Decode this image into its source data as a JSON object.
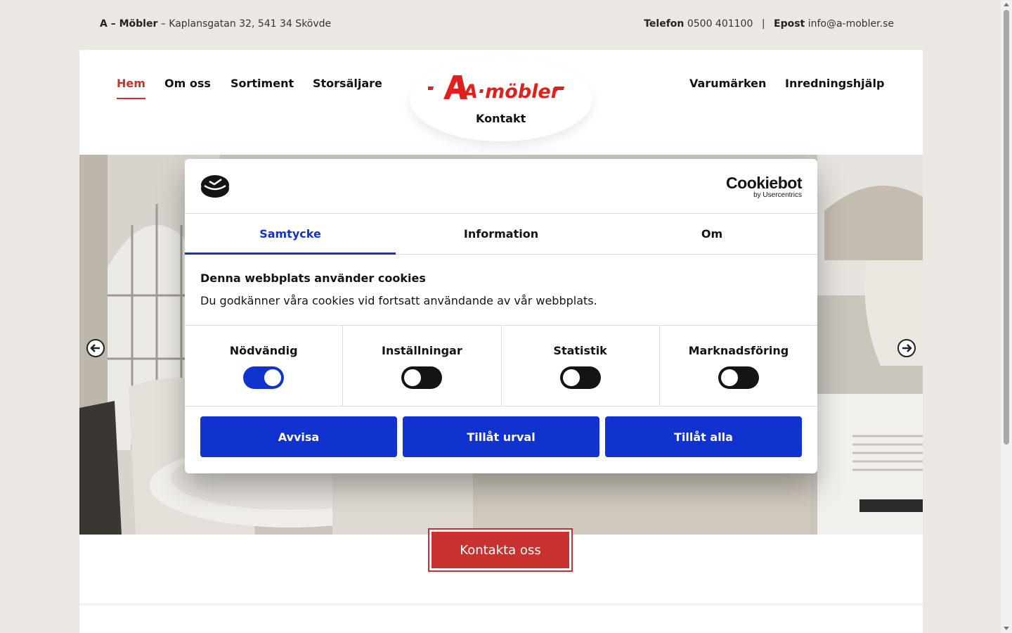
{
  "topbar": {
    "company": "A – Möbler",
    "address": " – Kaplansgatan 32, 541 34 Skövde",
    "phone_label": "Telefon",
    "phone": "0500 401100",
    "separator": "|",
    "email_label": "Epost",
    "email": "info@a-mobler.se"
  },
  "nav": {
    "left": [
      "Hem",
      "Om oss",
      "Sortiment",
      "Storsäljare"
    ],
    "right": [
      "Varumärken",
      "Inredningshjälp"
    ],
    "center": "Kontakt",
    "active": "Hem"
  },
  "logo": {
    "text": "A·möbler"
  },
  "hero": {
    "cta": "Kontakta oss"
  },
  "cookie": {
    "brand": "Cookiebot",
    "brand_sub": "by Usercentrics",
    "tabs": [
      "Samtycke",
      "Information",
      "Om"
    ],
    "active_tab": "Samtycke",
    "title": "Denna webbplats använder cookies",
    "text": "Du godkänner våra cookies vid fortsatt användande av vår webbplats.",
    "preferences": [
      {
        "label": "Nödvändig",
        "enabled": true
      },
      {
        "label": "Inställningar",
        "enabled": false
      },
      {
        "label": "Statistik",
        "enabled": false
      },
      {
        "label": "Marknadsföring",
        "enabled": false
      }
    ],
    "buttons": {
      "reject": "Avvisa",
      "allow_selection": "Tillåt urval",
      "allow_all": "Tillåt alla"
    }
  },
  "colors": {
    "brand_red": "#c8322e",
    "consent_blue": "#1032cf",
    "background": "#ebe8e4"
  }
}
